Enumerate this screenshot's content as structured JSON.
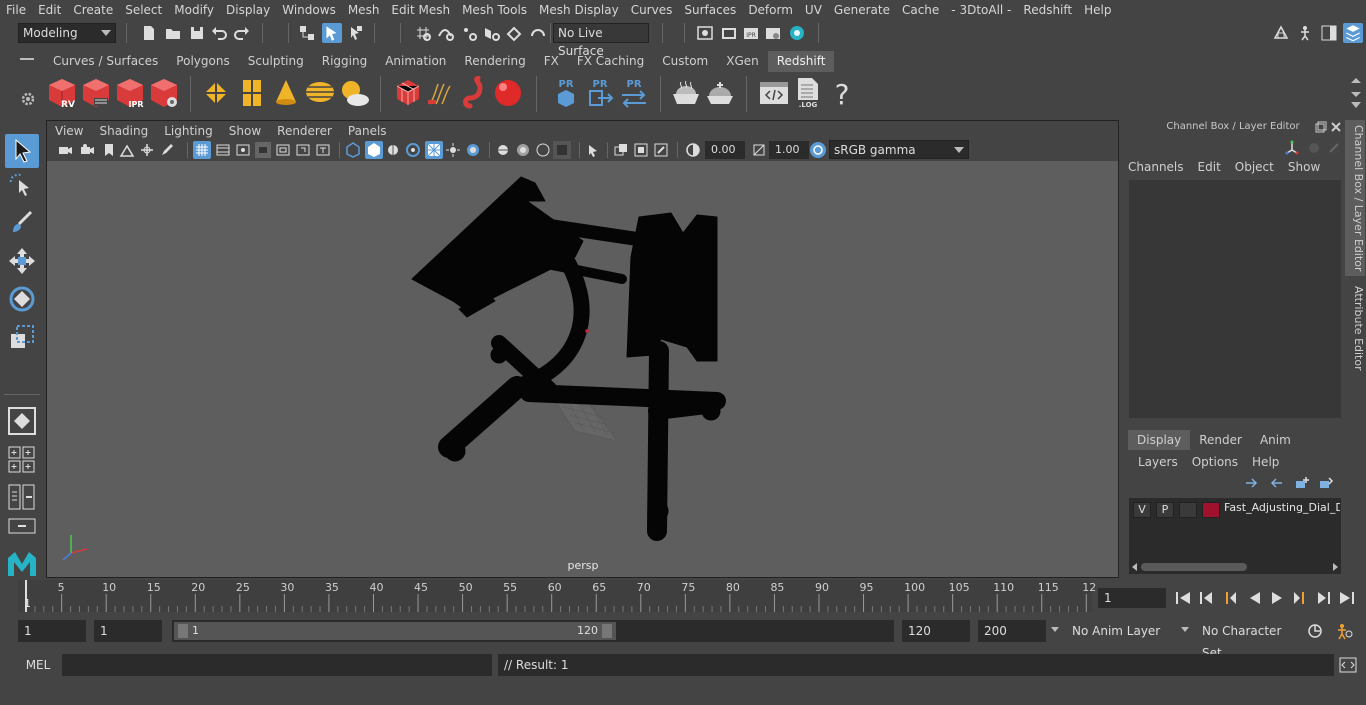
{
  "menubar": {
    "items": [
      "File",
      "Edit",
      "Create",
      "Select",
      "Modify",
      "Display",
      "Windows",
      "Mesh",
      "Edit Mesh",
      "Mesh Tools",
      "Mesh Display",
      "Curves",
      "Surfaces",
      "Deform",
      "UV",
      "Generate",
      "Cache",
      "- 3DtoAll -",
      "Redshift",
      "Help"
    ]
  },
  "statusline": {
    "workspace": "Modeling",
    "live_surface": "No Live Surface"
  },
  "shelf": {
    "tabs": [
      "Curves / Surfaces",
      "Polygons",
      "Sculpting",
      "Rigging",
      "Animation",
      "Rendering",
      "FX",
      "FX Caching",
      "Custom",
      "XGen",
      "Redshift"
    ],
    "active_tab": "Redshift",
    "icon_labels": {
      "rv": "RV",
      "ipr": "IPR",
      "pr1": "PR",
      "pr2": "PR",
      "pr3": "PR",
      "log": ".LOG",
      "help": "?"
    }
  },
  "viewport": {
    "menu": [
      "View",
      "Shading",
      "Lighting",
      "Show",
      "Renderer",
      "Panels"
    ],
    "exposure": "0.00",
    "gamma": "1.00",
    "color_space": "sRGB gamma",
    "camera_label": "persp"
  },
  "channelbox": {
    "title": "Channel Box / Layer Editor",
    "menu": [
      "Channels",
      "Edit",
      "Object",
      "Show"
    ],
    "layer_tabs": [
      "Display",
      "Render",
      "Anim"
    ],
    "active_layer_tab": "Display",
    "layer_menu": [
      "Layers",
      "Options",
      "Help"
    ],
    "layer": {
      "visible": "V",
      "playback": "P",
      "name": "Fast_Adjusting_Dial_D",
      "color": "#a0112d"
    }
  },
  "side_tabs": {
    "channel": "Channel Box / Layer Editor",
    "attribute": "Attribute Editor"
  },
  "timeline": {
    "ticks": [
      "5",
      "10",
      "15",
      "20",
      "25",
      "30",
      "35",
      "40",
      "45",
      "50",
      "55",
      "60",
      "65",
      "70",
      "75",
      "80",
      "85",
      "90",
      "95",
      "100",
      "105",
      "110",
      "115",
      "12"
    ],
    "start_marker": "1",
    "current_frame": "1"
  },
  "range": {
    "start": "1",
    "playback_start": "1",
    "slider_start": "1",
    "slider_end": "120",
    "playback_end": "120",
    "end": "200",
    "anim_layer": "No Anim Layer",
    "character_set": "No Character Set"
  },
  "cmd": {
    "language": "MEL",
    "result": "// Result: 1"
  },
  "colors": {
    "bg": "#444444",
    "viewport_bg": "#5e5e5e",
    "accent_blue": "#5b9bd5",
    "redshift_red": "#d93a3a"
  }
}
